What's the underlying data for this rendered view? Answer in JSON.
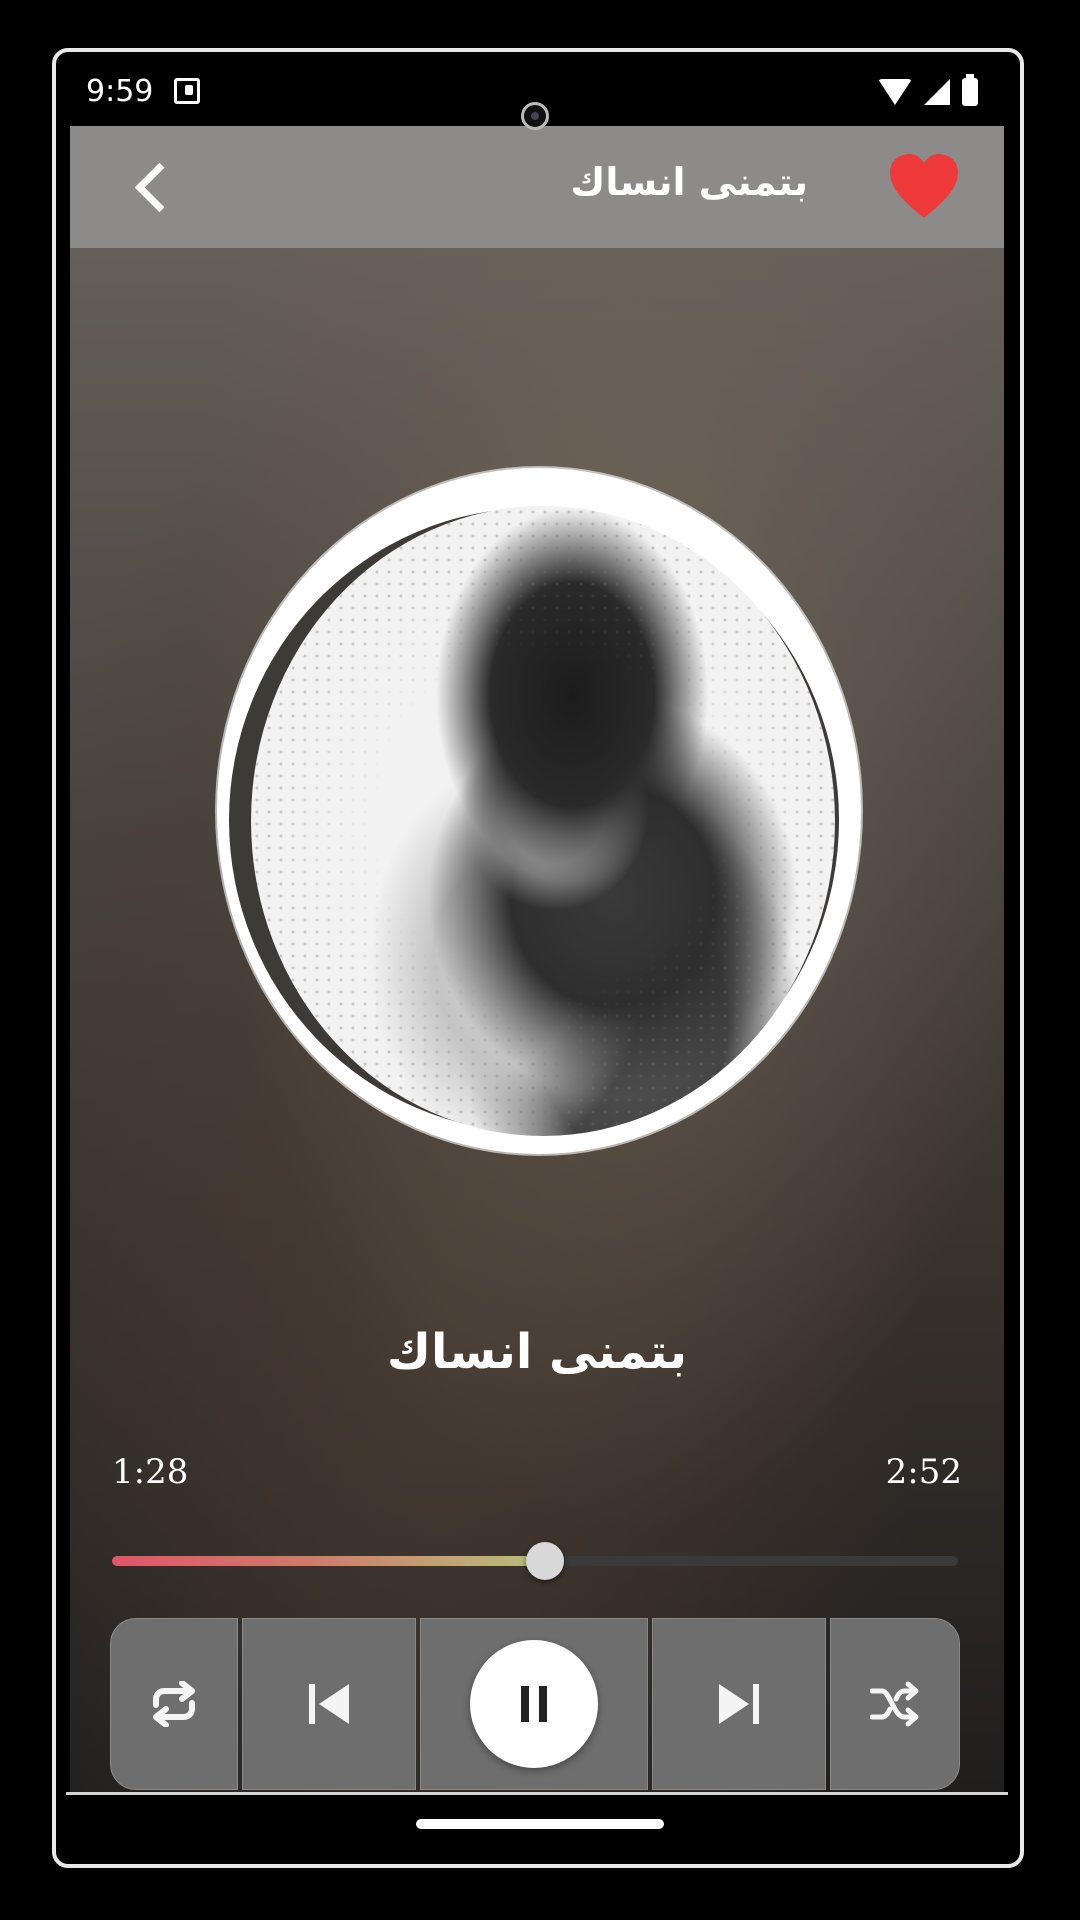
{
  "status_bar": {
    "time": "9:59",
    "icons": [
      "music-note-icon",
      "wifi-icon",
      "signal-icon",
      "battery-icon"
    ]
  },
  "header": {
    "title": "بتمنى انساك",
    "back_icon": "chevron-left-icon",
    "favorite_icon": "heart-icon",
    "favorite_color": "#ee3a3a"
  },
  "player": {
    "song_title": "بتمنى انساك",
    "time_elapsed": "1:28",
    "time_total": "2:52",
    "progress_fraction": 0.512,
    "is_playing": true
  },
  "controls": {
    "repeat_icon": "repeat-icon",
    "previous_icon": "skip-previous-icon",
    "play_pause_icon": "pause-icon",
    "next_icon": "skip-next-icon",
    "shuffle_icon": "shuffle-icon"
  },
  "colors": {
    "accent_start": "#e0566a",
    "accent_end": "#b8c07a",
    "heart": "#ee3a3a"
  }
}
